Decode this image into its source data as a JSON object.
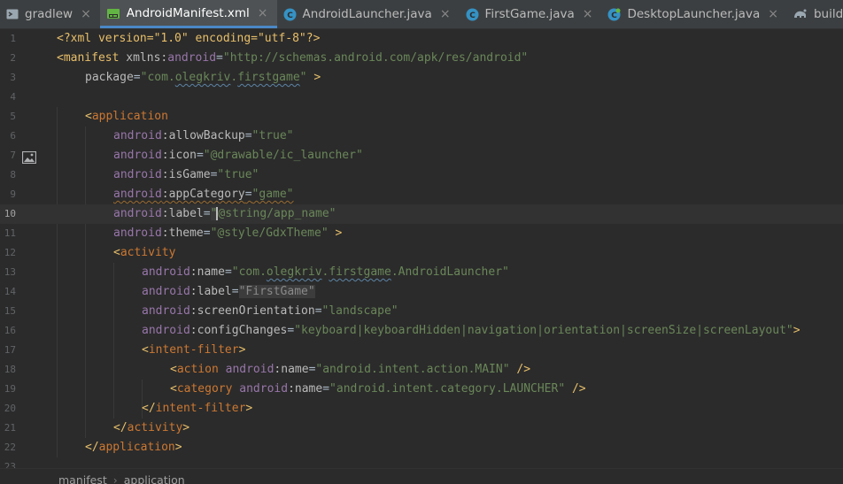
{
  "tabs": [
    {
      "label": "gradlew",
      "icon": "terminal-file-icon",
      "active": false
    },
    {
      "label": "AndroidManifest.xml",
      "icon": "manifest-file-icon",
      "active": true
    },
    {
      "label": "AndroidLauncher.java",
      "icon": "java-class-icon",
      "active": false
    },
    {
      "label": "FirstGame.java",
      "icon": "java-class-icon",
      "active": false
    },
    {
      "label": "DesktopLauncher.java",
      "icon": "java-class-icon",
      "active": false
    },
    {
      "label": "build.gradle (:andr",
      "icon": "gradle-icon",
      "active": false
    }
  ],
  "close_glyph": "×",
  "lines": [
    {
      "n": "1"
    },
    {
      "n": "2"
    },
    {
      "n": "3"
    },
    {
      "n": "4"
    },
    {
      "n": "5"
    },
    {
      "n": "6"
    },
    {
      "n": "7"
    },
    {
      "n": "8"
    },
    {
      "n": "9"
    },
    {
      "n": "10"
    },
    {
      "n": "11"
    },
    {
      "n": "12"
    },
    {
      "n": "13"
    },
    {
      "n": "14"
    },
    {
      "n": "15"
    },
    {
      "n": "16"
    },
    {
      "n": "17"
    },
    {
      "n": "18"
    },
    {
      "n": "19"
    },
    {
      "n": "20"
    },
    {
      "n": "21"
    },
    {
      "n": "22"
    },
    {
      "n": "23"
    }
  ],
  "code": {
    "l1_a": "<?xml version=\"1.0\" encoding=\"utf-8\"?>",
    "lt": "<",
    "gt": ">",
    "sp_gt": " >",
    "slash_gt": " />",
    "close_lt": "</",
    "eq": "=",
    "colon": ":",
    "sp": " ",
    "manifest": "manifest",
    "xmlns": "xmlns",
    "android": "android",
    "v_schema": "\"http://schemas.android.com/apk/res/android\"",
    "package": "package",
    "v_package_pre": "\"com.",
    "v_package_mid": "olegkriv",
    "v_package_dot": ".",
    "v_package_end": "firstgame",
    "v_package_close": "\"",
    "application": "application",
    "allowBackup": "allowBackup",
    "v_true": "\"true\"",
    "icon": "icon",
    "v_icon": "\"@drawable/ic_launcher\"",
    "isGame": "isGame",
    "appCategory": "appCategory",
    "v_game": "\"game\"",
    "label": "label",
    "v_appname_q": "\"",
    "v_appname": "@string/app_name\"",
    "theme": "theme",
    "v_theme": "\"@style/GdxTheme\"",
    "activity": "activity",
    "name": "name",
    "v_act_pre": "\"com.",
    "v_act_mid": "olegkriv",
    "v_act_dot": ".",
    "v_act_end": "firstgame",
    "v_act_tail": ".AndroidLauncher\"",
    "v_firstgame": "\"FirstGame\"",
    "screenOrientation": "screenOrientation",
    "v_landscape": "\"landscape\"",
    "configChanges": "configChanges",
    "v_config": "\"keyboard|keyboardHidden|navigation|orientation|screenSize|screenLayout\"",
    "intent_filter": "intent-filter",
    "action": "action",
    "v_main": "\"android.intent.action.MAIN\"",
    "category": "category",
    "v_launcher": "\"android.intent.category.LAUNCHER\""
  },
  "breadcrumb": {
    "items": [
      "manifest",
      "application"
    ],
    "separator": "›"
  },
  "colors": {
    "background": "#2b2b2b",
    "tag": "#e8bf6a",
    "namespace": "#9876aa",
    "string": "#6a8759",
    "keyword": "#cc7832",
    "accent": "#4a88c7"
  }
}
